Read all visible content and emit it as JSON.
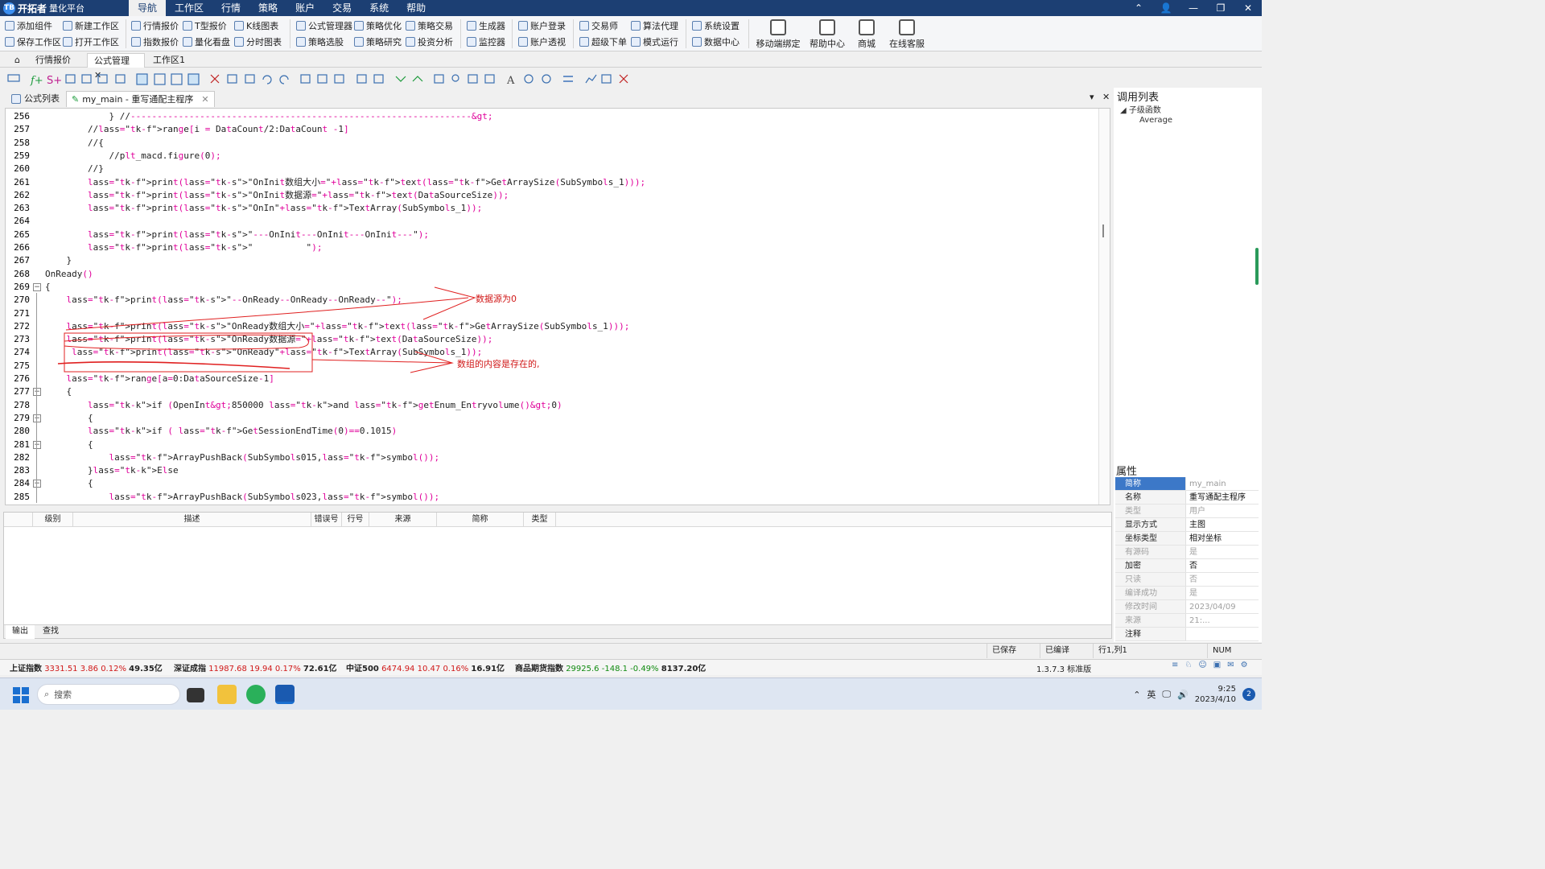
{
  "app": {
    "logo_mark": "TB",
    "name": "开拓者",
    "sub": "量化平台"
  },
  "menu": [
    "导航",
    "工作区",
    "行情",
    "策略",
    "账户",
    "交易",
    "系统",
    "帮助"
  ],
  "ribbon_small": [
    {
      "label": "添加组件",
      "icon": "add-component-icon"
    },
    {
      "label": "保存工作区",
      "icon": "save-icon"
    },
    {
      "label": "新建工作区",
      "icon": "new-workspace-icon"
    },
    {
      "label": "打开工作区",
      "icon": "folder-icon"
    },
    {
      "label": "行情报价",
      "icon": "quote-icon"
    },
    {
      "label": "指数报价",
      "icon": "index-quote-icon"
    },
    {
      "label": "T型报价",
      "icon": "t-quote-icon"
    },
    {
      "label": "量化看盘",
      "icon": "board-icon"
    },
    {
      "label": "K线图表",
      "icon": "kline-icon"
    },
    {
      "label": "分时图表",
      "icon": "timeshare-icon"
    },
    {
      "label": "公式管理器",
      "icon": "formula-icon"
    },
    {
      "label": "策略选股",
      "icon": "stock-pick-icon"
    },
    {
      "label": "策略优化",
      "icon": "optimize-icon"
    },
    {
      "label": "策略研究",
      "icon": "research-icon"
    },
    {
      "label": "策略交易",
      "icon": "strategy-trade-icon"
    },
    {
      "label": "投资分析",
      "icon": "analysis-icon"
    },
    {
      "label": "生成器",
      "icon": "generator-icon"
    },
    {
      "label": "监控器",
      "icon": "monitor-icon"
    },
    {
      "label": "账户登录",
      "icon": "account-login-icon"
    },
    {
      "label": "账户透视",
      "icon": "account-view-icon"
    },
    {
      "label": "交易师",
      "icon": "trader-icon"
    },
    {
      "label": "超级下单",
      "icon": "super-order-icon"
    },
    {
      "label": "算法代理",
      "icon": "algo-icon"
    },
    {
      "label": "模式运行",
      "icon": "mode-run-icon"
    },
    {
      "label": "系统设置",
      "icon": "gear-icon"
    },
    {
      "label": "数据中心",
      "icon": "data-center-icon"
    }
  ],
  "ribbon_big": [
    {
      "label": "移动端绑定",
      "icon": "mobile-icon"
    },
    {
      "label": "帮助中心",
      "icon": "help-book-icon"
    },
    {
      "label": "商城",
      "icon": "shop-icon"
    },
    {
      "label": "在线客服",
      "icon": "support-icon"
    }
  ],
  "workspace_tabs": [
    "行情报价",
    "公式管理",
    "工作区1"
  ],
  "editor_tabs": [
    "公式列表",
    "my_main - 重写通配主程序"
  ],
  "code_lines": [
    {
      "n": "256",
      "t": "            } //---------------------------------------------------------------->"
    },
    {
      "n": "257",
      "t": "        //range[i = DataCount/2:DataCount -1]"
    },
    {
      "n": "258",
      "t": "        //{"
    },
    {
      "n": "259",
      "t": "            //plt_macd.figure(0);"
    },
    {
      "n": "260",
      "t": "        //}"
    },
    {
      "n": "261",
      "t": "        print(\"OnInit数组大小=\"+text(GetArraySize(SubSymbols_1)));"
    },
    {
      "n": "262",
      "t": "        print(\"OnInit数据源=\"+text(DataSourceSize));"
    },
    {
      "n": "263",
      "t": "        print(\"OnIn\"+TextArray(SubSymbols_1));"
    },
    {
      "n": "264",
      "t": ""
    },
    {
      "n": "265",
      "t": "        print(\"---OnInit---OnInit---OnInit---\");"
    },
    {
      "n": "266",
      "t": "        print(\"          \");"
    },
    {
      "n": "267",
      "t": "    }"
    },
    {
      "n": "268",
      "t": "OnReady()"
    },
    {
      "n": "269",
      "t": "{"
    },
    {
      "n": "270",
      "t": "    print(\"--OnReady--OnReady--OnReady--\");"
    },
    {
      "n": "271",
      "t": ""
    },
    {
      "n": "272",
      "t": "    print(\"OnReady数组大小=\"+text(GetArraySize(SubSymbols_1)));"
    },
    {
      "n": "273",
      "t": "    print(\"OnReady数据源=\"+text(DataSourceSize));"
    },
    {
      "n": "274",
      "t": "     print(\"OnReady\"+TextArray(SubSymbols_1));"
    },
    {
      "n": "275",
      "t": ""
    },
    {
      "n": "276",
      "t": "    range[a=0:DataSourceSize-1]"
    },
    {
      "n": "277",
      "t": "    {"
    },
    {
      "n": "278",
      "t": "        if (OpenInt>850000 and getEnum_Entryvolume()>0)"
    },
    {
      "n": "279",
      "t": "        {"
    },
    {
      "n": "280",
      "t": "        if ( GetSessionEndTime(0)==0.1015)"
    },
    {
      "n": "281",
      "t": "        {"
    },
    {
      "n": "282",
      "t": "            ArrayPushBack(SubSymbols015,symbol());"
    },
    {
      "n": "283",
      "t": "        }Else"
    },
    {
      "n": "284",
      "t": "        {"
    },
    {
      "n": "285",
      "t": "            ArrayPushBack(SubSymbols023,symbol());"
    }
  ],
  "annotations": [
    "数据源为0",
    "数组的内容是存在的,"
  ],
  "call_list": {
    "title": "调用列表",
    "group": "子级函数",
    "item": "Average"
  },
  "properties": {
    "title": "属性",
    "rows": [
      {
        "k": "简称",
        "v": "my_main"
      },
      {
        "k": "名称",
        "v": "重写通配主程序"
      },
      {
        "k": "类型",
        "v": "用户"
      },
      {
        "k": "显示方式",
        "v": "主图"
      },
      {
        "k": "坐标类型",
        "v": "相对坐标"
      },
      {
        "k": "有源码",
        "v": "是"
      },
      {
        "k": "加密",
        "v": "否"
      },
      {
        "k": "只读",
        "v": "否"
      },
      {
        "k": "编译成功",
        "v": "是"
      },
      {
        "k": "修改时间",
        "v": "2023/04/09 21:..."
      },
      {
        "k": "来源",
        "v": ""
      },
      {
        "k": "注释",
        "v": ""
      }
    ]
  },
  "error_columns": [
    "级别",
    "描述",
    "错误号",
    "行号",
    "来源",
    "简称",
    "类型"
  ],
  "output_tabs": [
    "输出",
    "查找"
  ],
  "status": {
    "saved": "已保存",
    "compiled": "已编译",
    "pos": "行1,列1",
    "num": "NUM"
  },
  "market": [
    {
      "name": "上证指数",
      "price": "3331.51",
      "chg": "3.86",
      "pct": "0.12%",
      "amt": "49.35亿",
      "dir": "up"
    },
    {
      "name": "深证成指",
      "price": "11987.68",
      "chg": "19.94",
      "pct": "0.17%",
      "amt": "72.61亿",
      "dir": "up"
    },
    {
      "name": "中证500",
      "price": "6474.94",
      "chg": "10.47",
      "pct": "0.16%",
      "amt": "16.91亿",
      "dir": "up"
    },
    {
      "name": "商品期货指数",
      "price": "29925.6",
      "chg": "-148.1",
      "pct": "-0.49%",
      "amt": "8137.20亿",
      "dir": "down"
    }
  ],
  "version": "1.3.7.3 标准版",
  "taskbar": {
    "search": "搜索",
    "ime": "英",
    "time": "9:25",
    "date": "2023/4/10",
    "badge": "2"
  }
}
